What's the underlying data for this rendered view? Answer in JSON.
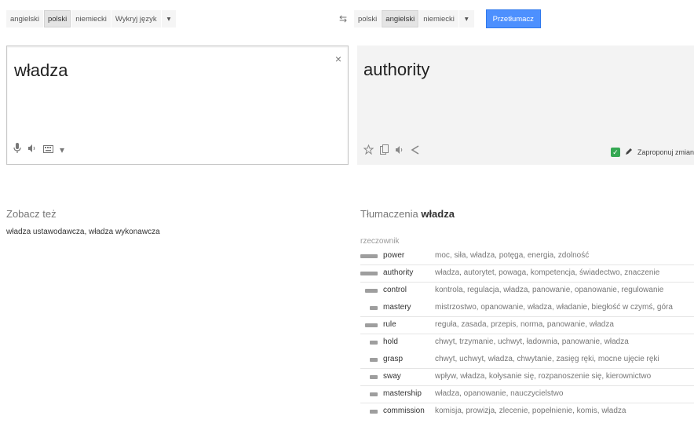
{
  "source_langs": [
    "angielski",
    "polski",
    "niemiecki",
    "Wykryj język"
  ],
  "source_active": "polski",
  "target_langs": [
    "polski",
    "angielski",
    "niemiecki"
  ],
  "target_active": "angielski",
  "translate_label": "Przetłumacz",
  "dropdown_glyph": "▾",
  "swap_glyph": "⇆",
  "source_text": "władza",
  "clear_glyph": "×",
  "translation": "authority",
  "suggest_label": "Zaproponuj zmian",
  "see_also": {
    "title": "Zobacz też",
    "items": "władza ustawodawcza, władza wykonawcza"
  },
  "translations_header": {
    "prefix": "Tłumaczenia",
    "word": "władza"
  },
  "pos_label": "rzeczownik",
  "rows": [
    {
      "word": "power",
      "synonyms": "moc, siła, władza, potęga, energia, zdolność",
      "freq": 3,
      "sep": true
    },
    {
      "word": "authority",
      "synonyms": "władza, autorytet, powaga, kompetencja, świadectwo, znaczenie",
      "freq": 3,
      "sep": true
    },
    {
      "word": "control",
      "synonyms": "kontrola, regulacja, władza, panowanie, opanowanie, regulowanie",
      "freq": 2,
      "sep": false
    },
    {
      "word": "mastery",
      "synonyms": "mistrzostwo, opanowanie, władza, władanie, biegłość w czymś, góra",
      "freq": 1,
      "sep": true
    },
    {
      "word": "rule",
      "synonyms": "reguła, zasada, przepis, norma, panowanie, władza",
      "freq": 2,
      "sep": true
    },
    {
      "word": "hold",
      "synonyms": "chwyt, trzymanie, uchwyt, ładownia, panowanie, władza",
      "freq": 1,
      "sep": false
    },
    {
      "word": "grasp",
      "synonyms": "chwyt, uchwyt, władza, chwytanie, zasięg ręki, mocne ujęcie ręki",
      "freq": 1,
      "sep": true
    },
    {
      "word": "sway",
      "synonyms": "wpływ, władza, kołysanie się, rozpanoszenie się, kierownictwo",
      "freq": 1,
      "sep": true
    },
    {
      "word": "mastership",
      "synonyms": "władza, opanowanie, nauczycielstwo",
      "freq": 1,
      "sep": true
    },
    {
      "word": "commission",
      "synonyms": "komisja, prowizja, zlecenie, popełnienie, komis, władza",
      "freq": 1,
      "sep": false
    }
  ],
  "icons": {
    "mic": "microphone-icon",
    "listen": "speaker-icon",
    "keyboard": "keyboard-icon",
    "star": "star-icon",
    "copy": "copy-icon",
    "share": "share-icon",
    "verified": "check-icon",
    "pencil": "pencil-icon"
  }
}
